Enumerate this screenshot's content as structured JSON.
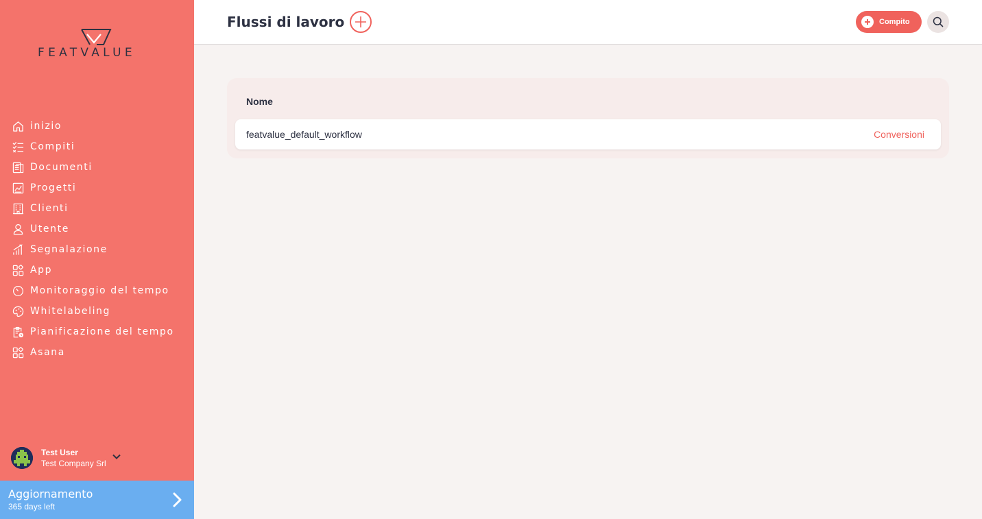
{
  "app": {
    "brand": "FEATVALUE",
    "colors": {
      "sidebar": "#f4736b",
      "accent": "#f0625c",
      "upgrade": "#6aaef0",
      "text": "#2d3142"
    }
  },
  "sidebar": {
    "items": [
      {
        "label": "inizio",
        "icon": "home-icon"
      },
      {
        "label": "Compiti",
        "icon": "checklist-icon"
      },
      {
        "label": "Documenti",
        "icon": "document-icon"
      },
      {
        "label": "Progetti",
        "icon": "chart-icon"
      },
      {
        "label": "Clienti",
        "icon": "building-icon"
      },
      {
        "label": "Utente",
        "icon": "user-icon"
      },
      {
        "label": "Segnalazione",
        "icon": "bar-chart-icon"
      },
      {
        "label": "App",
        "icon": "apps-icon"
      },
      {
        "label": "Monitoraggio del tempo",
        "icon": "timer-icon"
      },
      {
        "label": "Whitelabeling",
        "icon": "palette-icon"
      },
      {
        "label": "Pianificazione del tempo",
        "icon": "clipboard-clock-icon"
      },
      {
        "label": "Asana",
        "icon": "apps-icon"
      }
    ],
    "user": {
      "name": "Test User",
      "company": "Test Company Srl"
    },
    "upgrade": {
      "title": "Aggiornamento",
      "subtitle": "365 days left"
    }
  },
  "header": {
    "title": "Flussi di lavoro",
    "task_button": "Compito"
  },
  "table": {
    "column_name": "Nome",
    "rows": [
      {
        "name": "featvalue_default_workflow",
        "action": "Conversioni"
      }
    ]
  }
}
